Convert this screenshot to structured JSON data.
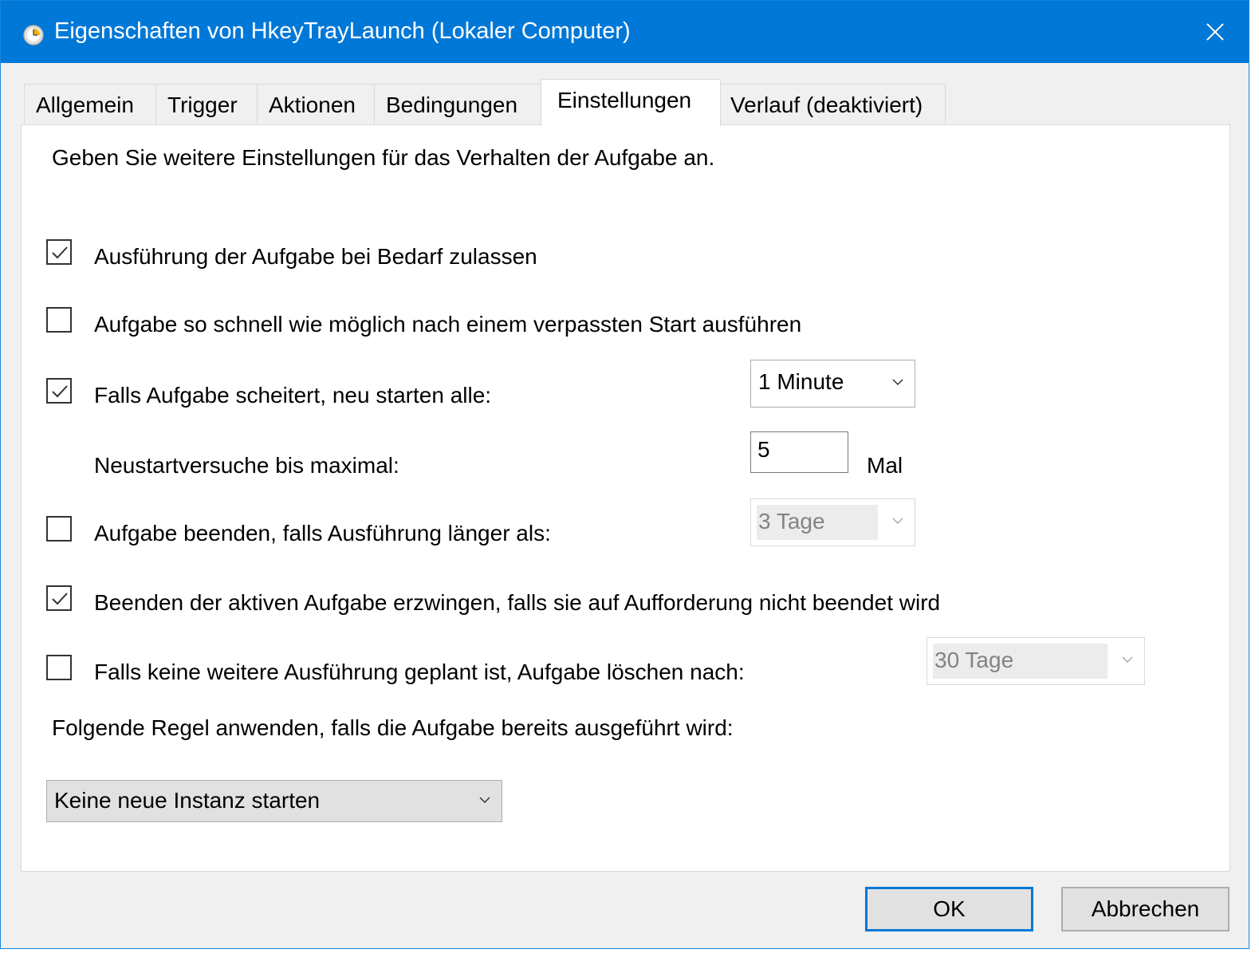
{
  "window": {
    "title": "Eigenschaften von HkeyTrayLaunch (Lokaler Computer)"
  },
  "tabs": [
    {
      "label": "Allgemein"
    },
    {
      "label": "Trigger"
    },
    {
      "label": "Aktionen"
    },
    {
      "label": "Bedingungen"
    },
    {
      "label": "Einstellungen",
      "active": true
    },
    {
      "label": "Verlauf (deaktiviert)"
    }
  ],
  "settings": {
    "intro": "Geben Sie weitere Einstellungen für das Verhalten der Aufgabe an.",
    "allow_on_demand": {
      "label": "Ausführung der Aufgabe bei Bedarf zulassen",
      "checked": true
    },
    "run_after_missed": {
      "label": "Aufgabe so schnell wie möglich nach einem verpassten Start ausführen",
      "checked": false
    },
    "restart_on_fail": {
      "label": "Falls Aufgabe scheitert, neu starten alle:",
      "checked": true,
      "interval": "1 Minute"
    },
    "restart_attempts": {
      "label": "Neustartversuche bis maximal:",
      "value": "5",
      "unit": "Mal"
    },
    "stop_if_longer": {
      "label": "Aufgabe beenden, falls Ausführung länger als:",
      "checked": false,
      "duration": "3 Tage"
    },
    "force_stop": {
      "label": "Beenden der aktiven Aufgabe erzwingen, falls sie auf Aufforderung nicht beendet wird",
      "checked": true
    },
    "delete_if_not_scheduled": {
      "label": "Falls keine weitere Ausführung geplant ist, Aufgabe löschen nach:",
      "checked": false,
      "duration": "30 Tage"
    },
    "rule_label": "Folgende Regel anwenden, falls die Aufgabe bereits ausgeführt wird:",
    "rule_value": "Keine neue Instanz starten"
  },
  "buttons": {
    "ok": "OK",
    "cancel": "Abbrechen"
  },
  "colors": {
    "titlebar": "#0078d7",
    "accent": "#0078d7",
    "dialog_bg": "#f0f0f0"
  }
}
